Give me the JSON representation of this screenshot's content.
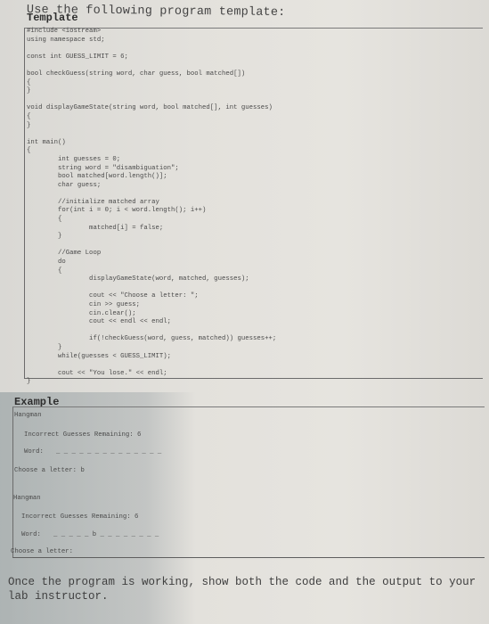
{
  "intro_text": "Use the following program template:",
  "template": {
    "title": "Template",
    "code_lines": [
      "#include <iostream>",
      "using namespace std;",
      "",
      "const int GUESS_LIMIT = 6;",
      "",
      "bool checkGuess(string word, char guess, bool matched[])",
      "{",
      "}",
      "",
      "void displayGameState(string word, bool matched[], int guesses)",
      "{",
      "}",
      "",
      "int main()",
      "{",
      "        int guesses = 0;",
      "        string word = \"disambiguation\";",
      "        bool matched[word.length()];",
      "        char guess;",
      "",
      "        //initialize matched array",
      "        for(int i = 0; i < word.length(); i++)",
      "        {",
      "                matched[i] = false;",
      "        }",
      "",
      "        //Game Loop",
      "        do",
      "        {",
      "                displayGameState(word, matched, guesses);",
      "",
      "                cout << \"Choose a letter: \";",
      "                cin >> guess;",
      "                cin.clear();",
      "                cout << endl << endl;",
      "",
      "                if(!checkGuess(word, guess, matched)) guesses++;",
      "        }",
      "        while(guesses < GUESS_LIMIT);",
      "",
      "        cout << \"You lose.\" << endl;",
      "}"
    ]
  },
  "example": {
    "title": "Example",
    "runs": [
      {
        "heading": "Hangman",
        "remaining_label": "Incorrect Guesses Remaining: 6",
        "word_label": "Word:",
        "word_display": "_ _ _ _ _ _ _ _ _ _ _ _ _ _",
        "prompt": "Choose a letter: b"
      },
      {
        "heading": "Hangman",
        "remaining_label": "Incorrect Guesses Remaining: 6",
        "word_label": "Word:",
        "word_display": "_ _ _ _ _ b _ _ _ _ _ _ _ _",
        "prompt": "Choose a letter:"
      }
    ]
  },
  "footer_text": "Once the program is working, show both the code and the output to your lab instructor."
}
